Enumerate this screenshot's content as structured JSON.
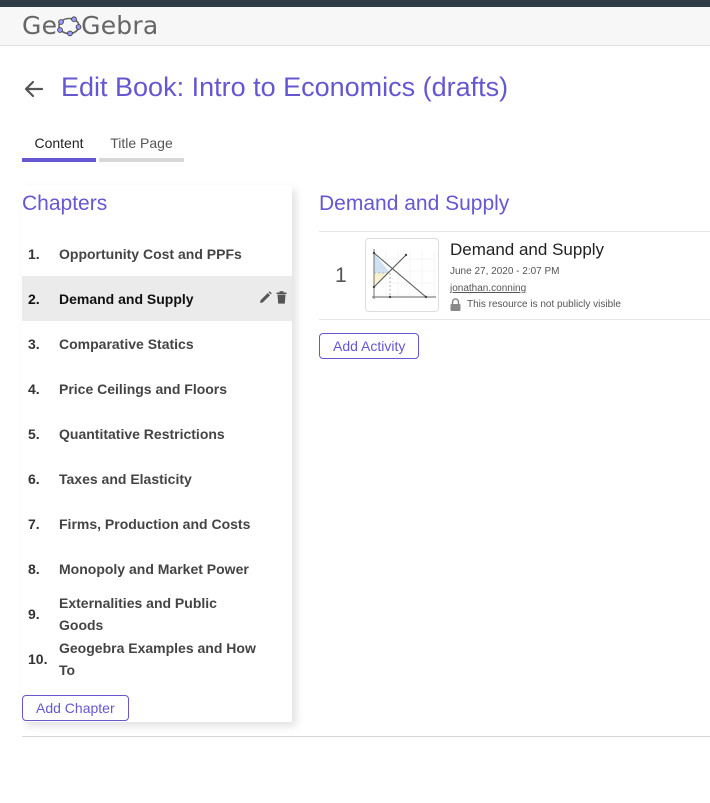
{
  "header": {
    "logo_text_left": "Ge",
    "logo_text_right": "Gebra"
  },
  "page": {
    "title": "Edit Book: Intro to Economics (drafts)"
  },
  "tabs": [
    {
      "label": "Content",
      "active": true
    },
    {
      "label": "Title Page",
      "active": false
    }
  ],
  "chapters": {
    "title": "Chapters",
    "items": [
      {
        "num": "1.",
        "label": "Opportunity Cost and PPFs"
      },
      {
        "num": "2.",
        "label": "Demand and Supply",
        "active": true
      },
      {
        "num": "3.",
        "label": "Comparative Statics"
      },
      {
        "num": "4.",
        "label": "Price Ceilings and Floors"
      },
      {
        "num": "5.",
        "label": "Quantitative Restrictions"
      },
      {
        "num": "6.",
        "label": "Taxes and Elasticity"
      },
      {
        "num": "7.",
        "label": "Firms, Production and Costs"
      },
      {
        "num": "8.",
        "label": "Monopoly and Market Power"
      },
      {
        "num": "9.",
        "label": "Externalities and Public Goods"
      },
      {
        "num": "10.",
        "label": "Geogebra Examples and How To"
      }
    ],
    "add_label": "Add Chapter"
  },
  "section": {
    "title": "Demand and Supply",
    "activities": [
      {
        "num": "1",
        "title": "Demand and Supply",
        "date": "June 27, 2020 - 2:07 PM",
        "author": "jonathan.conning",
        "visibility": "This resource is not publicly visible"
      }
    ],
    "add_label": "Add Activity"
  },
  "icons": {
    "back": "arrow-left-icon",
    "edit": "pencil-icon",
    "delete": "trash-icon",
    "lock": "lock-icon"
  },
  "colors": {
    "accent": "#6557d2",
    "topbar": "#2f3b45",
    "active_row": "#ebebeb"
  }
}
